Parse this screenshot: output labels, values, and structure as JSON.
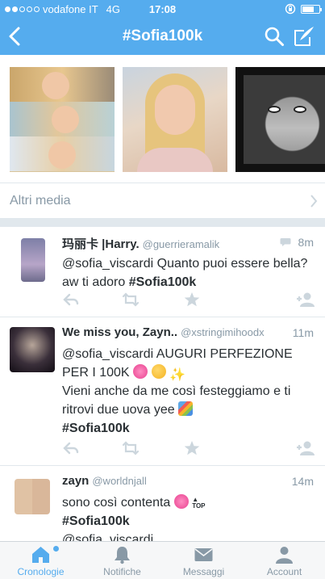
{
  "status_bar": {
    "carrier": "vodafone IT",
    "network": "4G",
    "time": "17:08",
    "signal_bars_filled": 2,
    "signal_bars_total": 5,
    "battery_level": 0.7
  },
  "nav": {
    "title": "#Sofia100k",
    "back_icon": "chevron-left-icon",
    "search_icon": "search-icon",
    "compose_icon": "compose-icon"
  },
  "media": {
    "more_label": "Altri media"
  },
  "tweets": [
    {
      "name": "玛丽卡 |Harry.",
      "handle": "@guerrieramalik",
      "time": "8m",
      "has_conversation": true,
      "lines": [
        "@sofia_viscardi Quanto puoi essere bella?",
        "aw ti adoro "
      ],
      "hashtag": "#Sofia100k"
    },
    {
      "name": "We miss you, Zayn..",
      "handle": "@xstringimihoodx",
      "time": "11m",
      "line1": "@sofia_viscardi AUGURI PERFEZIONE",
      "line2": "PER I 100K",
      "line3": "Vieni anche da me così festeggiamo e ti",
      "line4": "ritrovi due uova yee",
      "hashtag": "#Sofia100k"
    },
    {
      "name": "zayn",
      "handle": "@worldnjall",
      "time": "14m",
      "line1": "sono così contenta",
      "hashtag": "#Sofia100k",
      "line3": "@sofia_viscardi"
    }
  ],
  "tabs": [
    {
      "label": "Cronologie",
      "icon": "home-icon",
      "active": true
    },
    {
      "label": "Notifiche",
      "icon": "bell-icon",
      "active": false
    },
    {
      "label": "Messaggi",
      "icon": "envelope-icon",
      "active": false
    },
    {
      "label": "Account",
      "icon": "person-icon",
      "active": false
    }
  ],
  "colors": {
    "brand": "#55acee",
    "text": "#292f33",
    "muted": "#8899a6"
  }
}
